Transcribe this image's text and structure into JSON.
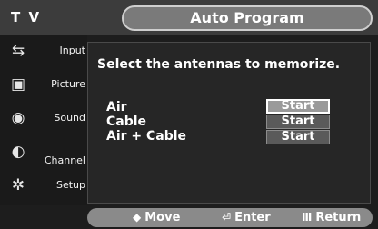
{
  "header": {
    "app_label": "T V",
    "title": "Auto Program"
  },
  "sidebar": {
    "items": [
      {
        "label": "Input",
        "icon": "input-icon",
        "glyph": "⇆"
      },
      {
        "label": "Picture",
        "icon": "picture-icon",
        "glyph": "▣"
      },
      {
        "label": "Sound",
        "icon": "sound-icon",
        "glyph": "◉"
      },
      {
        "label": "Channel",
        "icon": "channel-icon",
        "glyph": "◐"
      },
      {
        "label": "Setup",
        "icon": "setup-icon",
        "glyph": "✲"
      }
    ]
  },
  "main": {
    "prompt": "Select the antennas to memorize.",
    "options": [
      {
        "label": "Air",
        "button": "Start",
        "selected": true
      },
      {
        "label": "Cable",
        "button": "Start",
        "selected": false
      },
      {
        "label": "Air + Cable",
        "button": "Start",
        "selected": false
      }
    ]
  },
  "footer": {
    "move": {
      "icon": "move-arrows-icon",
      "glyph": "◆",
      "label": "Move"
    },
    "enter": {
      "icon": "enter-icon",
      "glyph": "⏎",
      "label": "Enter"
    },
    "return": {
      "icon": "return-icon",
      "glyph": "Ⅲ",
      "label": "Return"
    }
  }
}
